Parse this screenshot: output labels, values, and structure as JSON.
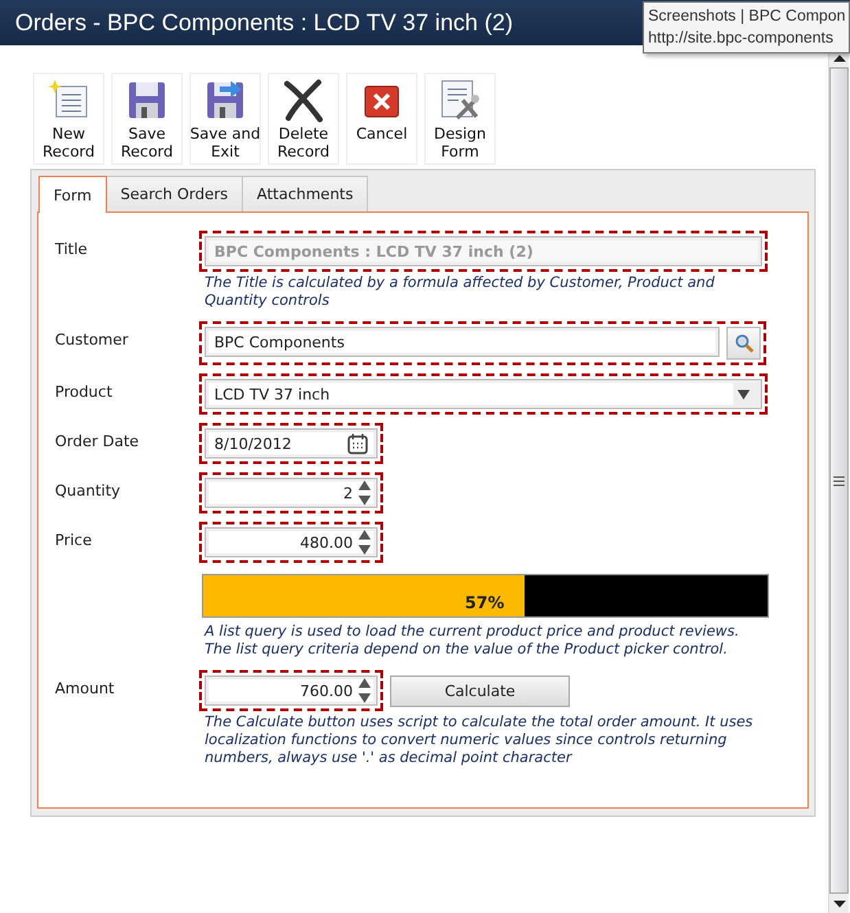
{
  "window": {
    "title": "Orders - BPC Components : LCD TV 37 inch (2)"
  },
  "tooltip": {
    "lines": [
      "Screenshots | BPC Compon",
      "http://site.bpc-components"
    ]
  },
  "toolbar": [
    {
      "kind": "new",
      "label": "New\nRecord"
    },
    {
      "kind": "save",
      "label": "Save\nRecord"
    },
    {
      "kind": "save-exit",
      "label": "Save and\nExit"
    },
    {
      "kind": "delete",
      "label": "Delete\nRecord"
    },
    {
      "kind": "cancel",
      "label": "Cancel"
    },
    {
      "kind": "design",
      "label": "Design\nForm"
    }
  ],
  "tabs": [
    {
      "label": "Form",
      "selected": true
    },
    {
      "label": "Search Orders",
      "selected": false
    },
    {
      "label": "Attachments",
      "selected": false
    }
  ],
  "fields": [
    {
      "kind": "text",
      "label": "Title",
      "value": "BPC Components : LCD TV 37 inch (2)",
      "disabled": true,
      "highlighted": true,
      "note": "The Title is calculated by a formula affected by Customer, Product and Quantity controls"
    },
    {
      "kind": "lookup",
      "label": "Customer",
      "value": "BPC Components",
      "disabled": false,
      "highlighted": true
    },
    {
      "kind": "dropdown",
      "label": "Product",
      "value": "LCD TV 37 inch",
      "disabled": false,
      "highlighted": true
    },
    {
      "kind": "date",
      "label": "Order Date",
      "value": "8/10/2012",
      "disabled": false,
      "highlighted": true
    },
    {
      "kind": "spin",
      "label": "Quantity",
      "value": "2",
      "disabled": false,
      "highlighted": true
    },
    {
      "kind": "spin",
      "label": "Price",
      "value": "480.00",
      "disabled": false,
      "highlighted": true
    },
    {
      "kind": "progress",
      "level": 0.57,
      "reading": "57%",
      "note": "A list query is used to load the current product price and product reviews. The list query criteria depend on the value of the Product picker control."
    },
    {
      "kind": "spin",
      "label": "Amount",
      "value": "760.00",
      "disabled": false,
      "highlighted": true,
      "button": "Calculate",
      "note": "The Calculate button uses script to calculate the total order amount. It uses localization functions to convert numeric values since controls returning numbers, always use '.' as decimal point character"
    }
  ]
}
